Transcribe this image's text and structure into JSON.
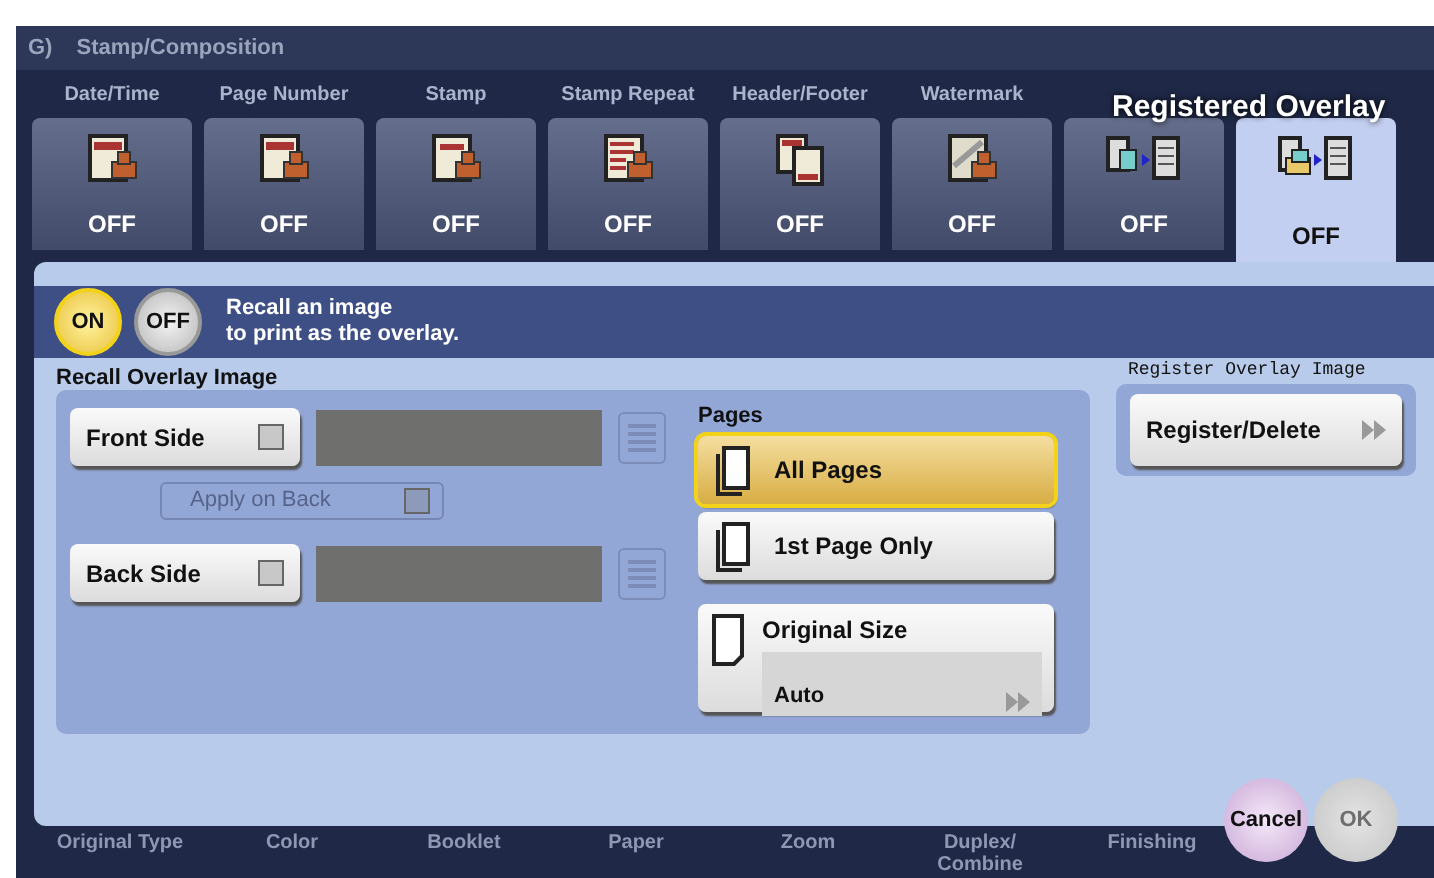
{
  "header": {
    "section": "G)",
    "title": "Stamp/Composition"
  },
  "tabs": [
    {
      "label": "Date/Time",
      "status": "OFF",
      "selected": false
    },
    {
      "label": "Page Number",
      "status": "OFF",
      "selected": false
    },
    {
      "label": "Stamp",
      "status": "OFF",
      "selected": false
    },
    {
      "label": "Stamp Repeat",
      "status": "OFF",
      "selected": false
    },
    {
      "label": "Header/Footer",
      "status": "OFF",
      "selected": false
    },
    {
      "label": "Watermark",
      "status": "OFF",
      "selected": false
    },
    {
      "status": "OFF",
      "selected": false
    },
    {
      "status": "OFF",
      "selected": true
    }
  ],
  "tooltip": "Registered Overlay",
  "toggle": [
    {
      "label": "ON",
      "selected": true
    },
    {
      "label": "OFF",
      "selected": false
    }
  ],
  "description": [
    "Recall an image",
    "to print as the overlay."
  ],
  "recall": {
    "title": "Recall Overlay Image",
    "front": {
      "label": "Front Side",
      "checked": false
    },
    "apply_on_back": {
      "label": "Apply on Back",
      "disabled": true
    },
    "back": {
      "label": "Back Side",
      "checked": false
    }
  },
  "pages": {
    "title": "Pages",
    "options": [
      {
        "label": "All Pages",
        "selected": true
      },
      {
        "label": "1st Page Only",
        "selected": false
      }
    ]
  },
  "original_size": {
    "label": "Original Size",
    "value": "Auto"
  },
  "register": {
    "title": "Register Overlay Image",
    "button": "Register/Delete"
  },
  "bottom_tabs": [
    [
      "Original Type"
    ],
    [
      "Color"
    ],
    [
      "Booklet"
    ],
    [
      "Paper"
    ],
    [
      "Zoom"
    ],
    [
      "Duplex/",
      "Combine"
    ],
    [
      "Finishing"
    ]
  ],
  "actions": [
    {
      "label": "Cancel",
      "disabled": false
    },
    {
      "label": "OK",
      "disabled": true
    }
  ]
}
